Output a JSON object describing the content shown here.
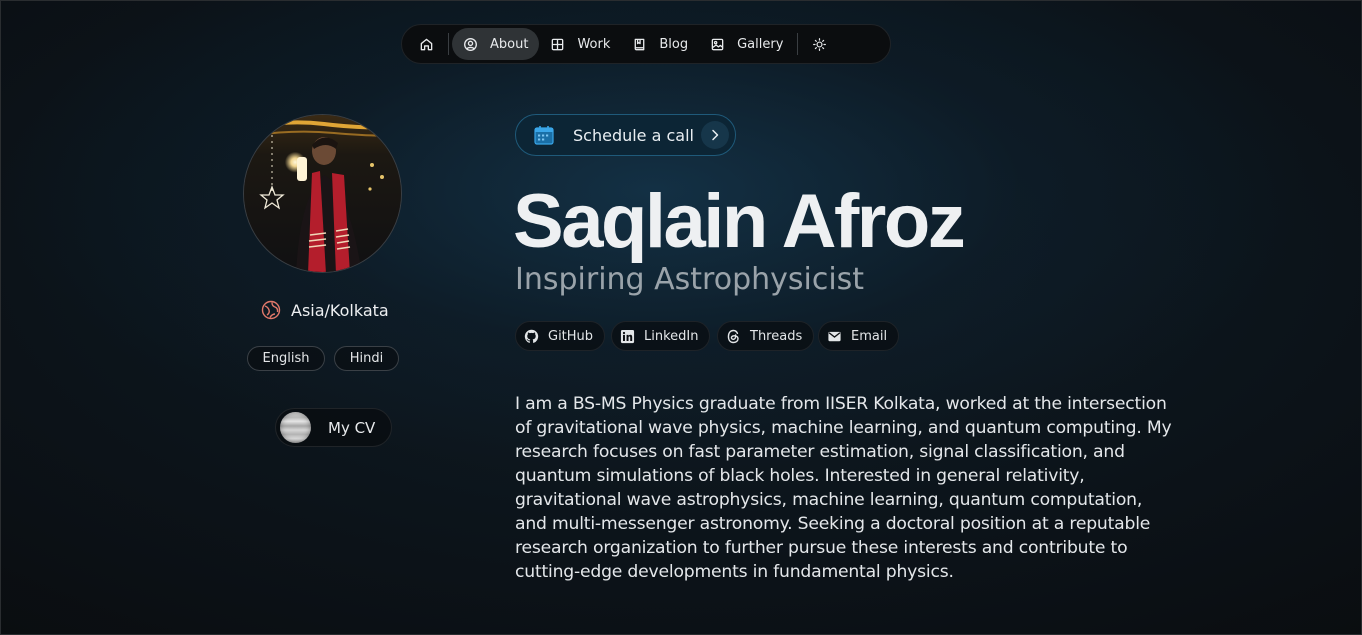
{
  "nav": {
    "home_icon": "home-icon",
    "items": [
      {
        "label": "About",
        "icon": "user-circle-icon",
        "active": true
      },
      {
        "label": "Work",
        "icon": "grid-icon"
      },
      {
        "label": "Blog",
        "icon": "book-icon"
      },
      {
        "label": "Gallery",
        "icon": "image-icon"
      }
    ],
    "theme_icon": "sun-icon"
  },
  "profile": {
    "avatar_alt": "avatar",
    "location": "Asia/Kolkata",
    "languages": [
      "English",
      "Hindi"
    ],
    "cv_label": "My CV"
  },
  "main": {
    "schedule_label": "Schedule a call",
    "name": "Saqlain Afroz",
    "role": "Inspiring Astrophysicist",
    "social": [
      {
        "label": "GitHub",
        "icon": "github-icon"
      },
      {
        "label": "LinkedIn",
        "icon": "linkedin-icon"
      },
      {
        "label": "Threads",
        "icon": "threads-icon"
      },
      {
        "label": "Email",
        "icon": "mail-icon"
      }
    ],
    "bio": "I am a BS-MS Physics graduate from IISER Kolkata, worked at the intersection of gravitational wave physics, machine learning, and quantum computing. My research focuses on fast parameter estimation, signal classification, and quantum simulations of black holes. Interested in general relativity, gravitational wave astrophysics, machine learning, quantum computation, and multi-messenger astronomy. Seeking a doctoral position at a reputable research organization to further pursue these interests and contribute to cutting-edge developments in fundamental physics."
  },
  "colors": {
    "accent": "#1f5a7a",
    "calendar": "#3aa6e8",
    "location_icon": "#e0786a"
  }
}
